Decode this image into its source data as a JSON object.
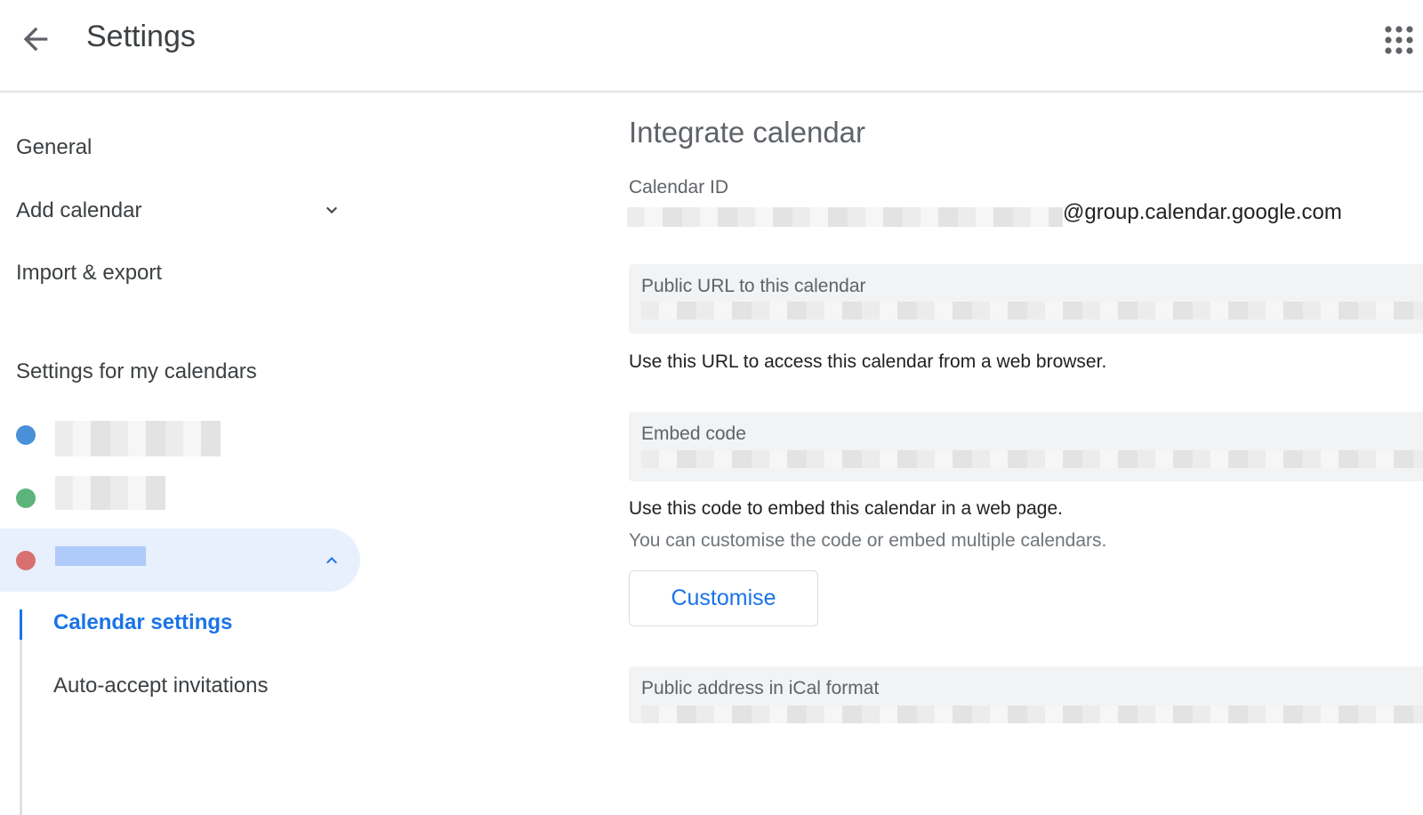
{
  "header": {
    "title": "Settings",
    "back_icon": "arrow-back-icon",
    "apps_icon": "apps-grid-icon"
  },
  "sidebar": {
    "items": [
      {
        "label": "General"
      },
      {
        "label": "Add calendar",
        "icon": "chevron-down-icon"
      },
      {
        "label": "Import & export"
      }
    ],
    "section_title": "Settings for my calendars",
    "calendars": [
      {
        "color": "#4a90d9"
      },
      {
        "color": "#5cb37c"
      },
      {
        "color": "#d97070",
        "expanded": true,
        "icon": "chevron-up-icon"
      }
    ],
    "sub_items": [
      {
        "label": "Calendar settings",
        "active": true
      },
      {
        "label": "Auto-accept invitations"
      }
    ]
  },
  "main": {
    "title": "Integrate calendar",
    "calendar_id_label": "Calendar ID",
    "calendar_id_suffix": "@group.calendar.google.com",
    "public_url_label": "Public URL to this calendar",
    "public_url_help": "Use this URL to access this calendar from a web browser.",
    "embed_label": "Embed code",
    "embed_help": "Use this code to embed this calendar in a web page.",
    "embed_help_2": "You can customise the code or embed multiple calendars.",
    "customise_button": "Customise",
    "ical_label": "Public address in iCal format"
  },
  "colors": {
    "accent": "#1a73e8",
    "active_bg": "#e8f0fe",
    "field_bg": "#f1f3f4"
  }
}
